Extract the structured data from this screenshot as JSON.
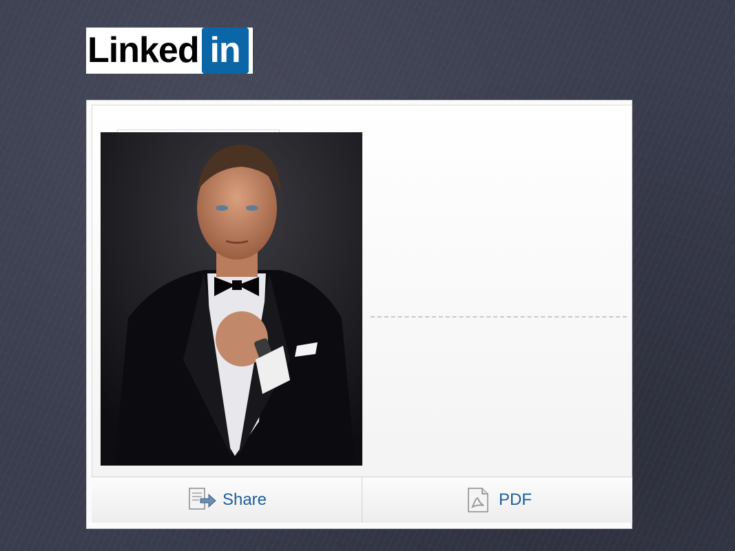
{
  "brand": {
    "logo_word": "Linked",
    "logo_box_text": "in",
    "accent_color": "#0a66a7"
  },
  "profile": {
    "photo_icon": "profile-photo"
  },
  "toolbar": {
    "share_label": "Share",
    "share_icon": "share-icon",
    "pdf_label": "PDF",
    "pdf_icon": "pdf-icon",
    "label_color": "#1e5f9e"
  }
}
